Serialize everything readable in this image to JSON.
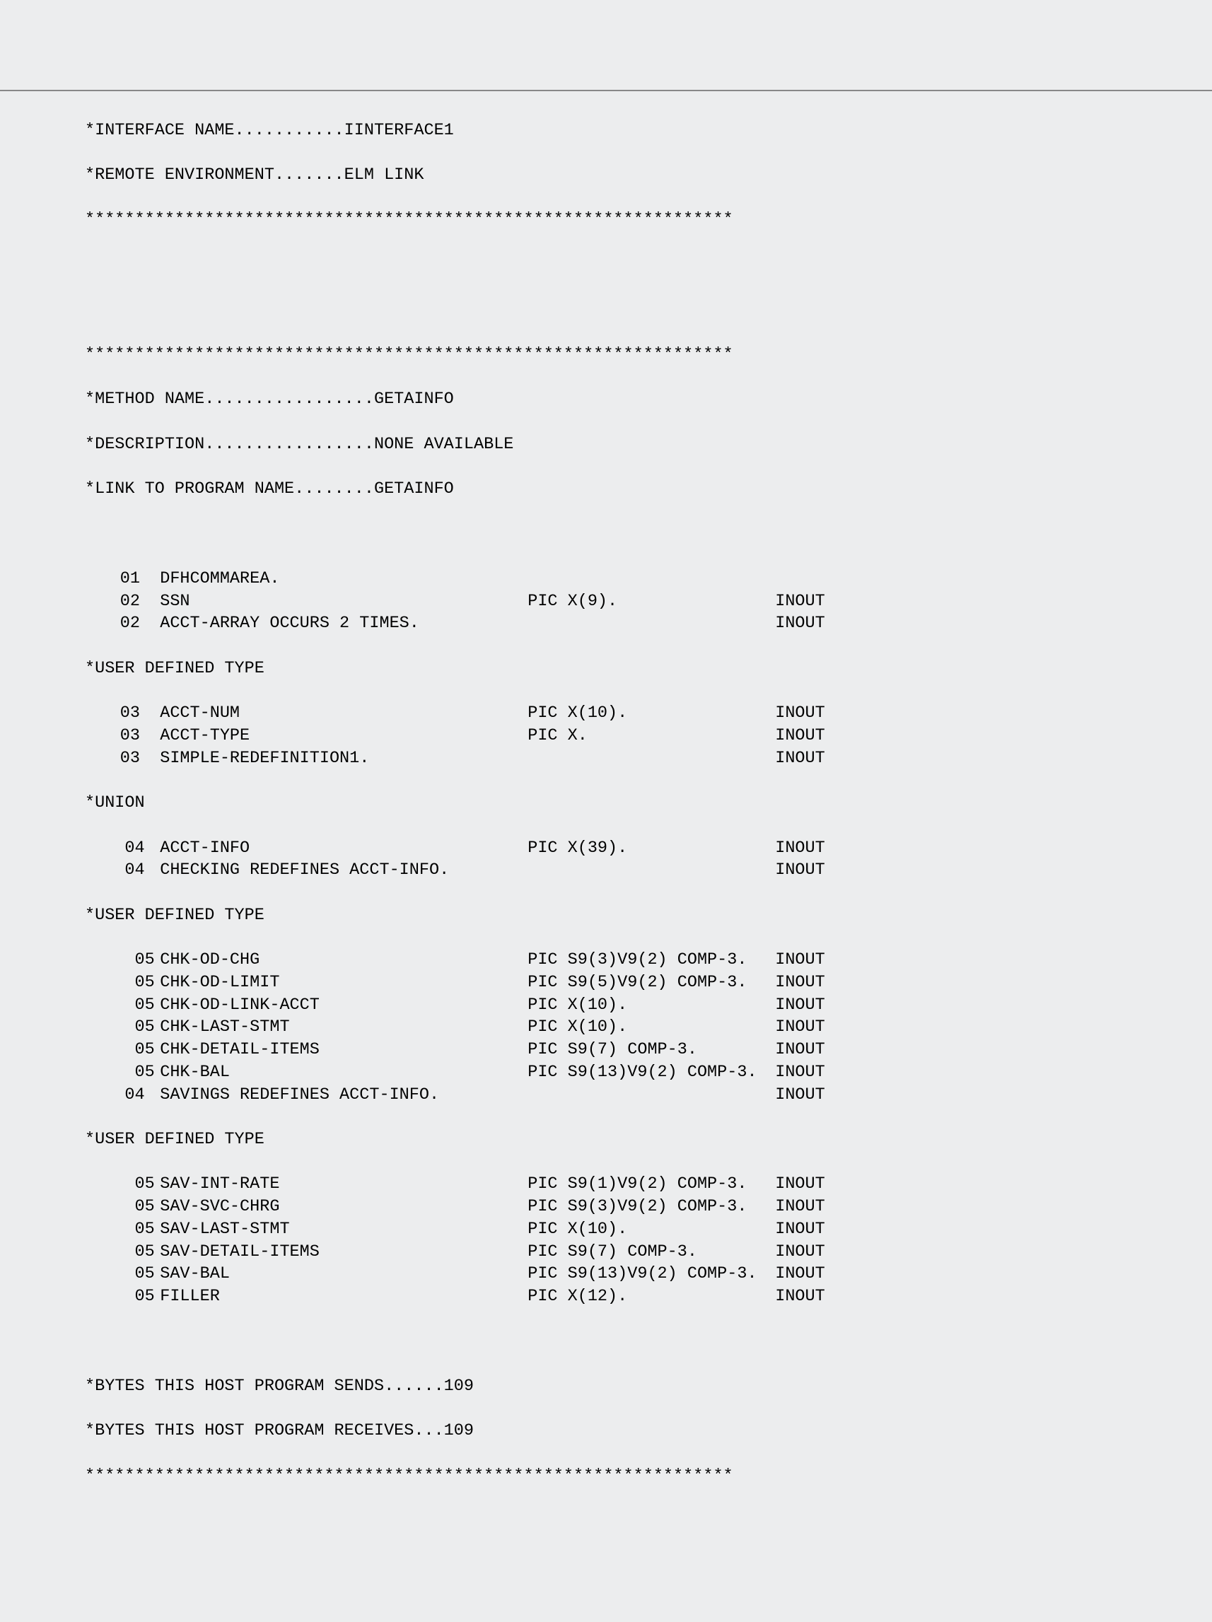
{
  "header": {
    "interfaceNameLabel": "*INTERFACE NAME...........IINTERFACE1",
    "remoteEnvLabel": "*REMOTE ENVIRONMENT.......ELM LINK",
    "starsLine": "*****************************************************************"
  },
  "method": {
    "starsLine": "*****************************************************************",
    "methodNameLabel": "*METHOD NAME.................GETAINFO",
    "descriptionLabel": "*DESCRIPTION.................NONE AVAILABLE",
    "linkLabel": "*LINK TO PROGRAM NAME........GETAINFO"
  },
  "structLines": [
    {
      "lvl": " 01",
      "name": "DFHCOMMAREA.",
      "pic": "",
      "dir": ""
    },
    {
      "lvl": "  02",
      "name": "SSN",
      "pic": "PIC X(9).",
      "dir": "INOUT"
    },
    {
      "lvl": "  02",
      "name": "ACCT-ARRAY OCCURS 2 TIMES.",
      "pic": "",
      "dir": "INOUT"
    }
  ],
  "udt1": "*USER DEFINED TYPE",
  "structLines2": [
    {
      "lvl": "   03",
      "name": "ACCT-NUM",
      "pic": "PIC X(10).",
      "dir": "INOUT"
    },
    {
      "lvl": "   03",
      "name": "ACCT-TYPE",
      "pic": "PIC X.",
      "dir": "INOUT"
    },
    {
      "lvl": "   03",
      "name": "SIMPLE-REDEFINITION1.",
      "pic": "",
      "dir": "INOUT"
    }
  ],
  "union": "*UNION",
  "structLines3": [
    {
      "lvl": "    04",
      "name": "ACCT-INFO",
      "pic": "PIC X(39).",
      "dir": "INOUT"
    },
    {
      "lvl": "    04",
      "name": "CHECKING REDEFINES ACCT-INFO.",
      "pic": "",
      "dir": "INOUT"
    }
  ],
  "udt2": "*USER DEFINED TYPE",
  "structLines4": [
    {
      "lvl": "     05",
      "name": "CHK-OD-CHG",
      "pic": "PIC S9(3)V9(2) COMP-3.",
      "dir": "INOUT"
    },
    {
      "lvl": "     05",
      "name": "CHK-OD-LIMIT",
      "pic": "PIC S9(5)V9(2) COMP-3.",
      "dir": "INOUT"
    },
    {
      "lvl": "     05",
      "name": "CHK-OD-LINK-ACCT",
      "pic": "PIC X(10).",
      "dir": "INOUT"
    },
    {
      "lvl": "     05",
      "name": "CHK-LAST-STMT",
      "pic": "PIC X(10).",
      "dir": "INOUT"
    },
    {
      "lvl": "     05",
      "name": "CHK-DETAIL-ITEMS",
      "pic": "PIC S9(7) COMP-3.",
      "dir": "INOUT"
    },
    {
      "lvl": "     05",
      "name": "CHK-BAL",
      "pic": "PIC S9(13)V9(2) COMP-3.",
      "dir": "INOUT"
    },
    {
      "lvl": "    04",
      "name": "SAVINGS REDEFINES ACCT-INFO.",
      "pic": "",
      "dir": "INOUT"
    }
  ],
  "udt3": "*USER DEFINED TYPE",
  "structLines5": [
    {
      "lvl": "     05",
      "name": "SAV-INT-RATE",
      "pic": "PIC S9(1)V9(2) COMP-3.",
      "dir": "INOUT"
    },
    {
      "lvl": "     05",
      "name": "SAV-SVC-CHRG",
      "pic": "PIC S9(3)V9(2) COMP-3.",
      "dir": "INOUT"
    },
    {
      "lvl": "     05",
      "name": "SAV-LAST-STMT",
      "pic": "PIC X(10).",
      "dir": "INOUT"
    },
    {
      "lvl": "     05",
      "name": "SAV-DETAIL-ITEMS",
      "pic": "PIC S9(7) COMP-3.",
      "dir": "INOUT"
    },
    {
      "lvl": "     05",
      "name": "SAV-BAL",
      "pic": "PIC S9(13)V9(2) COMP-3.",
      "dir": "INOUT"
    },
    {
      "lvl": "     05",
      "name": "FILLER",
      "pic": "PIC X(12).",
      "dir": "INOUT"
    }
  ],
  "footer": {
    "sendsLabel": "*BYTES THIS HOST PROGRAM SENDS......109",
    "receivesLabel": "*BYTES THIS HOST PROGRAM RECEIVES...109",
    "starsLine": "*****************************************************************"
  }
}
